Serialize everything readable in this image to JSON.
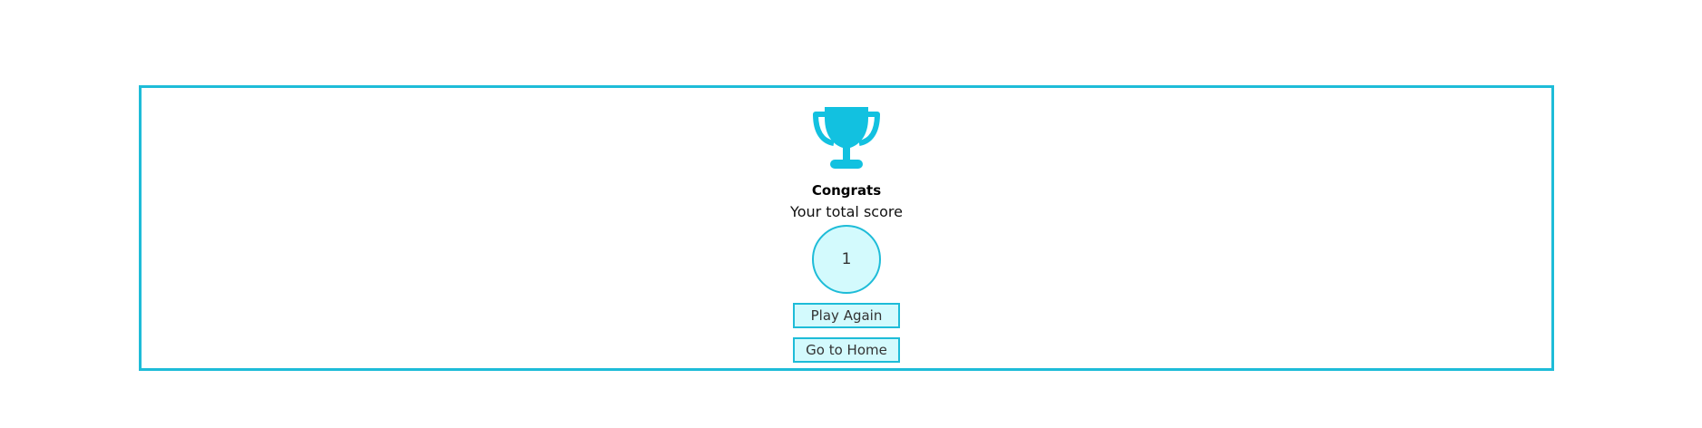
{
  "result": {
    "title": "Congrats",
    "subtitle": "Your total score",
    "score": "1"
  },
  "actions": {
    "play_again_label": "Play Again",
    "home_label": "Go to Home"
  },
  "icons": {
    "trophy": "trophy-icon"
  },
  "colors": {
    "accent": "#1ebcd8",
    "score_fill": "#d3fafd",
    "trophy": "#12c1e0"
  }
}
